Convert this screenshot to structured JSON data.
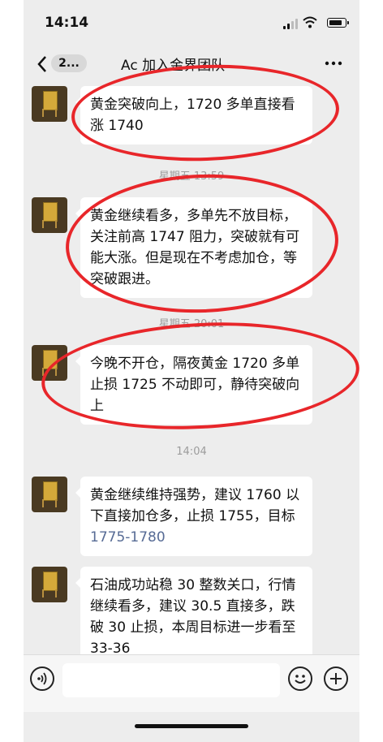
{
  "status": {
    "time": "14:14"
  },
  "nav": {
    "badge": "2...",
    "title": "Ac 加入金界团队"
  },
  "messages": [
    {
      "text": "黄金突破向上，1720 多单直接看涨 1740"
    },
    {
      "text": "黄金继续看多，多单先不放目标，关注前高 1747 阻力，突破就有可能大涨。但是现在不考虑加仓，等突破跟进。"
    },
    {
      "text": "今晚不开仓，隔夜黄金 1720 多单止损 1725 不动即可，静待突破向上"
    },
    {
      "text": "黄金继续维持强势，建议 1760 以下直接加仓多，止损 1755，目标",
      "link": "1775-1780"
    },
    {
      "text": "石油成功站稳 30 整数关口，行情继续看多，建议 30.5 直接多，跌破 30 止损，本周目标进一步看至 33-36"
    }
  ],
  "timestamps": [
    "星期五 13:59",
    "星期五 20:01",
    "14:04"
  ],
  "colors": {
    "annotation": "#e8262a",
    "link": "#576b95",
    "background": "#ededed"
  },
  "icons": {
    "back": "chevron-left-icon",
    "more": "more-dots-icon",
    "voice": "voice-icon",
    "emoji": "emoji-icon",
    "plus": "plus-icon"
  }
}
